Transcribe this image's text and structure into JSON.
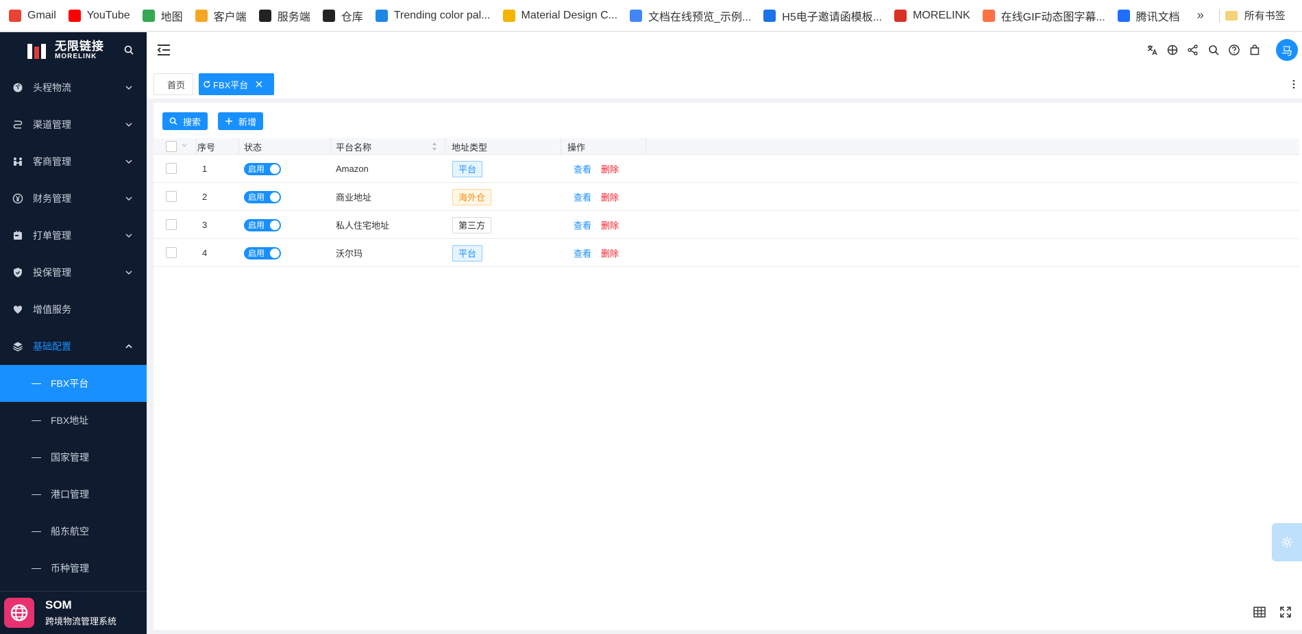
{
  "bookmarks": [
    {
      "label": "Gmail",
      "icon": "gmail-icon",
      "color": "#ea4335"
    },
    {
      "label": "YouTube",
      "icon": "youtube-icon",
      "color": "#ff0000"
    },
    {
      "label": "地图",
      "icon": "maps-icon",
      "color": "#34a853"
    },
    {
      "label": "客户端",
      "icon": "client-icon",
      "color": "#f5a623"
    },
    {
      "label": "服务端",
      "icon": "morelink-icon",
      "color": "#222222"
    },
    {
      "label": "仓库",
      "icon": "morelink-icon",
      "color": "#222222"
    },
    {
      "label": "Trending color pal...",
      "icon": "coolors-icon",
      "color": "#1e88e5"
    },
    {
      "label": "Material Design C...",
      "icon": "material-icon",
      "color": "#f4b400"
    },
    {
      "label": "文档在线预览_示例...",
      "icon": "doc-icon",
      "color": "#4285f4"
    },
    {
      "label": "H5电子邀请函模板...",
      "icon": "h5-icon",
      "color": "#1a73e8"
    },
    {
      "label": "MORELINK",
      "icon": "gmail-icon",
      "color": "#d93025"
    },
    {
      "label": "在线GIF动态图字幕...",
      "icon": "gif-icon",
      "color": "#ff7043"
    },
    {
      "label": "腾讯文档",
      "icon": "tencent-doc-icon",
      "color": "#1e6fff"
    }
  ],
  "bookmarks_more": "»",
  "bookmarks_folder": "所有书签",
  "brand": {
    "cn": "无限链接",
    "en": "MORELINK"
  },
  "menu": [
    {
      "label": "头程物流",
      "icon": "globe-icon"
    },
    {
      "label": "渠道管理",
      "icon": "route-icon"
    },
    {
      "label": "客商管理",
      "icon": "users-icon"
    },
    {
      "label": "财务管理",
      "icon": "yen-icon"
    },
    {
      "label": "打单管理",
      "icon": "print-icon"
    },
    {
      "label": "投保管理",
      "icon": "shield-icon"
    },
    {
      "label": "增值服务",
      "icon": "heart-icon"
    },
    {
      "label": "基础配置",
      "icon": "layers-icon"
    }
  ],
  "submenu": [
    "FBX平台",
    "FBX地址",
    "国家管理",
    "港口管理",
    "船东航空",
    "币种管理"
  ],
  "footer": {
    "title": "SOM",
    "subtitle": "跨境物流管理系统"
  },
  "header": {
    "avatar": "马"
  },
  "tabs": {
    "home": "首页",
    "active": "FBX平台"
  },
  "toolbar": {
    "search": "搜索",
    "add": "新增"
  },
  "table": {
    "columns": [
      "序号",
      "状态",
      "平台名称",
      "地址类型",
      "操作"
    ],
    "rows": [
      {
        "no": "1",
        "status": "启用",
        "name": "Amazon",
        "type": "平台",
        "type_style": "blue"
      },
      {
        "no": "2",
        "status": "启用",
        "name": "商业地址",
        "type": "海外仓",
        "type_style": "orange"
      },
      {
        "no": "3",
        "status": "启用",
        "name": "私人住宅地址",
        "type": "第三方",
        "type_style": "plain"
      },
      {
        "no": "4",
        "status": "启用",
        "name": "沃尔玛",
        "type": "平台",
        "type_style": "blue"
      }
    ],
    "action_view": "查看",
    "action_delete": "删除"
  },
  "colors": {
    "primary": "#1890ff",
    "sidebar": "#0f1b2e",
    "danger": "#f5222d"
  }
}
